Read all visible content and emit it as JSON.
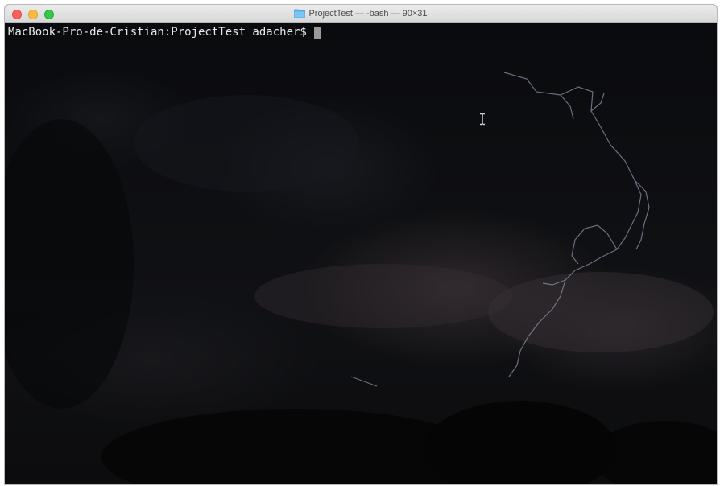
{
  "window": {
    "title": "ProjectTest — -bash — 90×31",
    "controls": {
      "close": "close-button",
      "minimize": "minimize-button",
      "zoom": "zoom-button"
    },
    "title_icon": "folder-icon"
  },
  "terminal": {
    "prompt": "MacBook-Pro-de-Cristian:ProjectTest adacher$",
    "input": "",
    "background": "lightning-storm-wallpaper",
    "mouse_cursor": "text-ibeam-cursor"
  },
  "colors": {
    "close": "#fc605c",
    "minimize": "#fdbc40",
    "zoom": "#34c84a",
    "folder": "#5fb6f0",
    "terminal_text": "#e8e8e8"
  }
}
